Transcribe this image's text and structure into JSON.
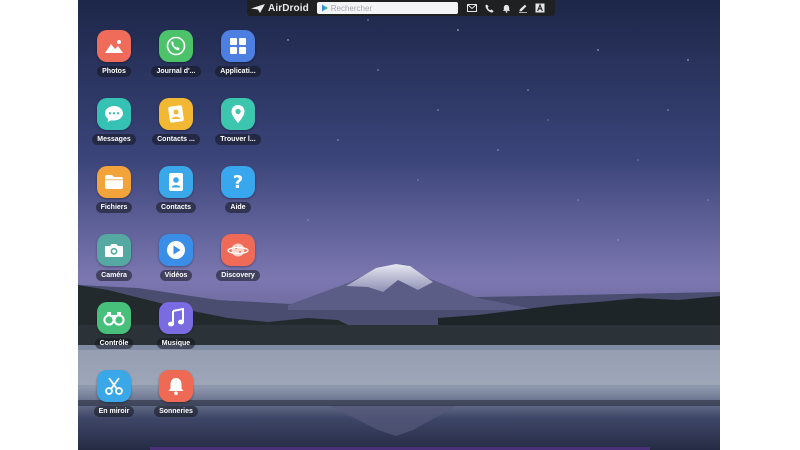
{
  "toolbar": {
    "brand": "AirDroid",
    "search_placeholder": "Rechercher",
    "icons": [
      "mail-icon",
      "phone-icon",
      "bell-icon",
      "pen-icon",
      "text-icon"
    ]
  },
  "apps": [
    {
      "label": "Photos",
      "icon": "photos-icon",
      "color": "#ef6b5a"
    },
    {
      "label": "Journal d'...",
      "icon": "call-log-icon",
      "color": "#4cc26a"
    },
    {
      "label": "Applicati...",
      "icon": "apps-grid-icon",
      "color": "#4c7fe0"
    },
    {
      "label": "Messages",
      "icon": "messages-icon",
      "color": "#35c2b5"
    },
    {
      "label": "Contacts ...",
      "icon": "contacts-card-icon",
      "color": "#f3b833"
    },
    {
      "label": "Trouver l...",
      "icon": "find-phone-icon",
      "color": "#3cc6ad"
    },
    {
      "label": "Fichiers",
      "icon": "folder-icon",
      "color": "#f2a33a"
    },
    {
      "label": "Contacts",
      "icon": "contacts-icon",
      "color": "#3aa8e8"
    },
    {
      "label": "Aide",
      "icon": "help-icon",
      "color": "#39a7ee"
    },
    {
      "label": "Caméra",
      "icon": "camera-icon",
      "color": "#56a9a3"
    },
    {
      "label": "Vidéos",
      "icon": "video-icon",
      "color": "#3a8ee8"
    },
    {
      "label": "Discovery",
      "icon": "planet-icon",
      "color": "#ef6b58"
    },
    {
      "label": "Contrôle",
      "icon": "binoculars-icon",
      "color": "#47c07b"
    },
    {
      "label": "Musique",
      "icon": "music-icon",
      "color": "#7b6be0"
    },
    {
      "label": "En miroir",
      "icon": "scissors-icon",
      "color": "#3aa8e8"
    },
    {
      "label": "Sonneries",
      "icon": "bell-app-icon",
      "color": "#ef6a55"
    }
  ]
}
